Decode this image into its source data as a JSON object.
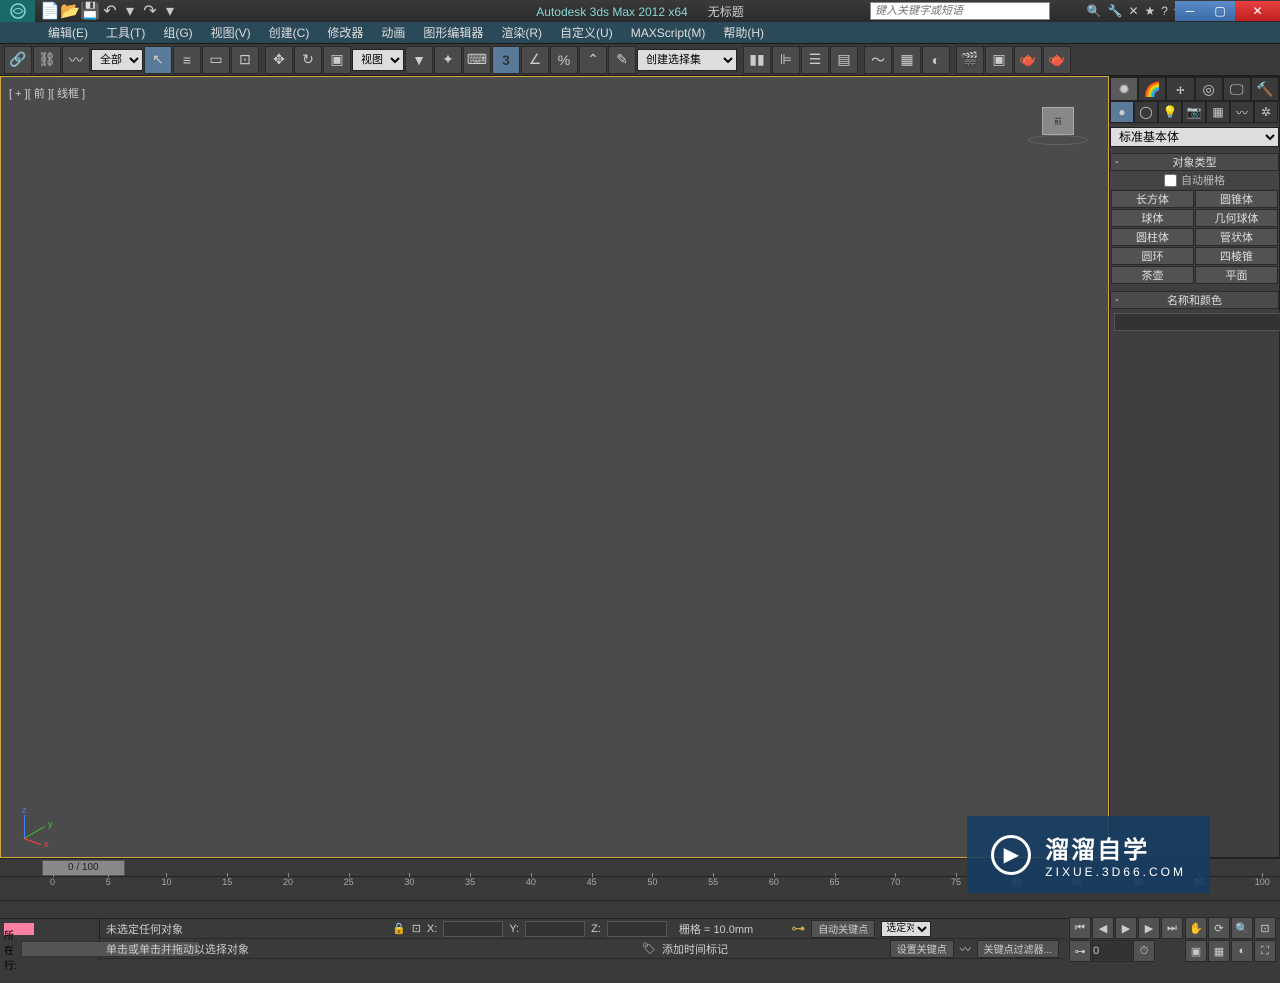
{
  "title": {
    "app": "Autodesk 3ds Max  2012 x64",
    "doc": "无标题",
    "search_placeholder": "键入关键字或短语"
  },
  "menubar": [
    "编辑(E)",
    "工具(T)",
    "组(G)",
    "视图(V)",
    "创建(C)",
    "修改器",
    "动画",
    "图形编辑器",
    "渲染(R)",
    "自定义(U)",
    "MAXScript(M)",
    "帮助(H)"
  ],
  "toolbar": {
    "filter_combo": "全部",
    "ref_combo": "视图",
    "named_sel": "创建选择集"
  },
  "viewport": {
    "label": "[ + ][ 前 ][ 线框 ]"
  },
  "panel": {
    "primitive_combo": "标准基本体",
    "rollout_objtype": "对象类型",
    "autogrid": "自动栅格",
    "buttons": [
      "长方体",
      "圆锥体",
      "球体",
      "几何球体",
      "圆柱体",
      "管状体",
      "圆环",
      "四棱锥",
      "茶壶",
      "平面"
    ],
    "rollout_namecolor": "名称和颜色"
  },
  "timeline": {
    "slider": "0 / 100",
    "marks": [
      "0",
      "5",
      "10",
      "15",
      "20",
      "25",
      "30",
      "35",
      "40",
      "45",
      "50",
      "55",
      "60",
      "65",
      "70",
      "75",
      "80",
      "85",
      "90",
      "95",
      "100"
    ]
  },
  "status": {
    "selection": "未选定任何对象",
    "hint": "单击或单击并拖动以选择对象",
    "x": "X:",
    "y": "Y:",
    "z": "Z:",
    "grid": "栅格 = 10.0mm",
    "add_time_tag": "添加时间标记",
    "auto_key": "自动关键点",
    "set_key": "设置关键点",
    "key_filters": "关键点过滤器...",
    "selected_combo": "选定对",
    "script_label": "所在行:"
  },
  "watermark": {
    "title": "溜溜自学",
    "url": "ZIXUE.3D66.COM"
  }
}
